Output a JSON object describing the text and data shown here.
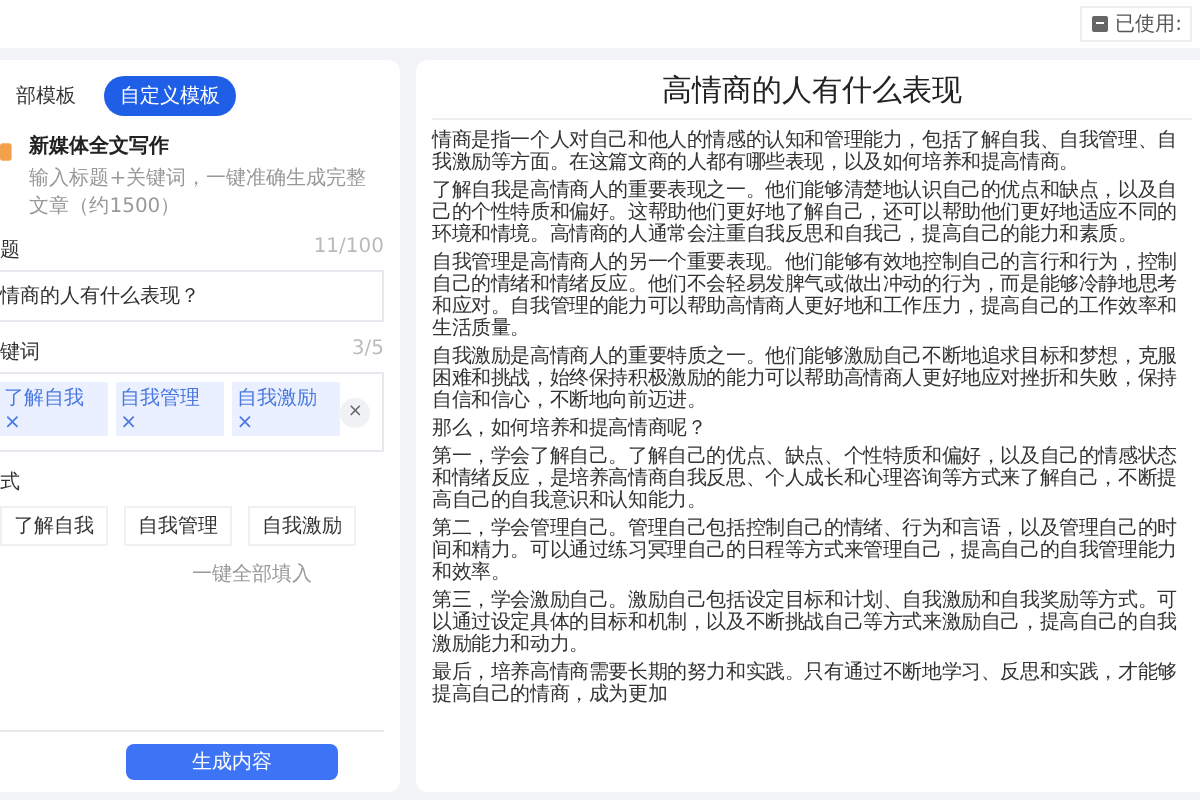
{
  "header": {
    "usage_label": "已使用:"
  },
  "left_panel": {
    "tabs": [
      {
        "label": "部模板",
        "selected": false
      },
      {
        "label": "自定义模板",
        "selected": true
      }
    ],
    "template": {
      "title": "新媒体全文写作",
      "description": "输入标题+关键词，一键准确生成完整文章（约1500）"
    },
    "title_field": {
      "label": "题",
      "count": "11/100",
      "value": "情商的人有什么表现？"
    },
    "keyword_field": {
      "label": "键词",
      "count": "3/5",
      "tags": [
        "了解自我 ×",
        "自我管理 ×",
        "自我激励 ×"
      ],
      "clear": "×"
    },
    "suggest": {
      "label": "式",
      "chips": [
        "了解自我",
        "自我管理",
        "自我激励"
      ],
      "fill_all": "一键全部填入"
    },
    "generate_button": "生成内容"
  },
  "article": {
    "title": "高情商的人有什么表现",
    "paragraphs": [
      "情商是指一个人对自己和他人的情感的认知和管理能力，包括了解自我、自我管理、自我激励等方面。在这篇文商的人都有哪些表现，以及如何培养和提高情商。",
      "了解自我是高情商人的重要表现之一。他们能够清楚地认识自己的优点和缺点，以及自己的个性特质和偏好。这帮助他们更好地了解自己，还可以帮助他们更好地适应不同的环境和情境。高情商的人通常会注重自我反思和自我己，提高自己的能力和素质。",
      "自我管理是高情商人的另一个重要表现。他们能够有效地控制自己的言行和行为，控制自己的情绪和情绪反应。他们不会轻易发脾气或做出冲动的行为，而是能够冷静地思考和应对。自我管理的能力可以帮助高情商人更好地和工作压力，提高自己的工作效率和生活质量。",
      "自我激励是高情商人的重要特质之一。他们能够激励自己不断地追求目标和梦想，克服困难和挑战，始终保持积极激励的能力可以帮助高情商人更好地应对挫折和失败，保持自信和信心，不断地向前迈进。",
      "那么，如何培养和提高情商呢？",
      "第一，学会了解自己。了解自己的优点、缺点、个性特质和偏好，以及自己的情感状态和情绪反应，是培养高情商自我反思、个人成长和心理咨询等方式来了解自己，不断提高自己的自我意识和认知能力。",
      "第二，学会管理自己。管理自己包括控制自己的情绪、行为和言语，以及管理自己的时间和精力。可以通过练习冥理自己的日程等方式来管理自己，提高自己的自我管理能力和效率。",
      "第三，学会激励自己。激励自己包括设定目标和计划、自我激励和自我奖励等方式。可以通过设定具体的目标和机制，以及不断挑战自己等方式来激励自己，提高自己的自我激励能力和动力。",
      "最后，培养高情商需要长期的努力和实践。只有通过不断地学习、反思和实践，才能够提高自己的情商，成为更加"
    ]
  }
}
